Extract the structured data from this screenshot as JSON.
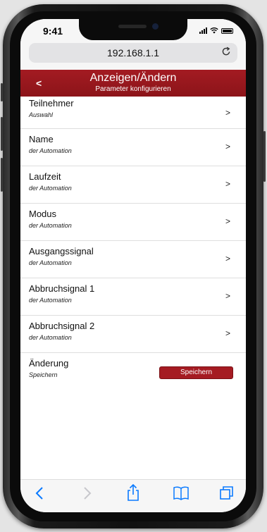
{
  "status": {
    "time": "9:41"
  },
  "browser": {
    "url": "192.168.1.1"
  },
  "header": {
    "back_label": "<",
    "title": "Anzeigen/Ändern",
    "subtitle": "Parameter konfigurieren"
  },
  "rows": [
    {
      "label": "Teilnehmer",
      "sub": "Auswahl",
      "arrow": ">"
    },
    {
      "label": "Name",
      "sub": "der Automation",
      "arrow": ">"
    },
    {
      "label": "Laufzeit",
      "sub": "der Automation",
      "arrow": ">"
    },
    {
      "label": "Modus",
      "sub": "der Automation",
      "arrow": ">"
    },
    {
      "label": "Ausgangssignal",
      "sub": "der Automation",
      "arrow": ">"
    },
    {
      "label": "Abbruchsignal 1",
      "sub": "der Automation",
      "arrow": ">"
    },
    {
      "label": "Abbruchsignal 2",
      "sub": "der Automation",
      "arrow": ">"
    },
    {
      "label": "Änderung",
      "sub": "Speichern",
      "button": "Speichern"
    }
  ],
  "colors": {
    "accent": "#a31b22",
    "ios_blue": "#0a7aff"
  },
  "icons": [
    "reload-icon",
    "back-arrow-icon",
    "forward-arrow-icon",
    "share-icon",
    "bookmarks-icon",
    "tabs-icon"
  ]
}
